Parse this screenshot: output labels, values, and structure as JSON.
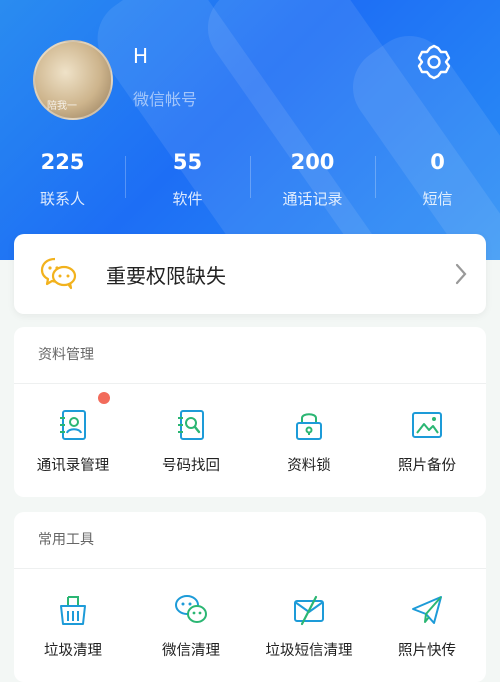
{
  "profile": {
    "username": "H",
    "account_label": "微信帐号",
    "avatar_watermark": "陪我一"
  },
  "stats": [
    {
      "value": "225",
      "label": "联系人"
    },
    {
      "value": "55",
      "label": "软件"
    },
    {
      "value": "200",
      "label": "通话记录"
    },
    {
      "value": "0",
      "label": "短信"
    }
  ],
  "permission_banner": {
    "title": "重要权限缺失"
  },
  "data_management": {
    "title": "资料管理",
    "items": [
      {
        "label": "通讯录管理",
        "icon": "contact-book-icon"
      },
      {
        "label": "号码找回",
        "icon": "number-search-icon"
      },
      {
        "label": "资料锁",
        "icon": "lock-icon"
      },
      {
        "label": "照片备份",
        "icon": "photo-icon"
      }
    ]
  },
  "tools": {
    "title": "常用工具",
    "items": [
      {
        "label": "垃圾清理",
        "icon": "broom-icon"
      },
      {
        "label": "微信清理",
        "icon": "wechat-icon"
      },
      {
        "label": "垃圾短信清理",
        "icon": "spam-message-icon"
      },
      {
        "label": "照片快传",
        "icon": "paper-plane-icon"
      }
    ]
  },
  "colors": {
    "accent": "#1d9bd8",
    "accent_green": "#2bb673",
    "header_blue": "#1d6ef5",
    "badge": "#f26b5b"
  }
}
